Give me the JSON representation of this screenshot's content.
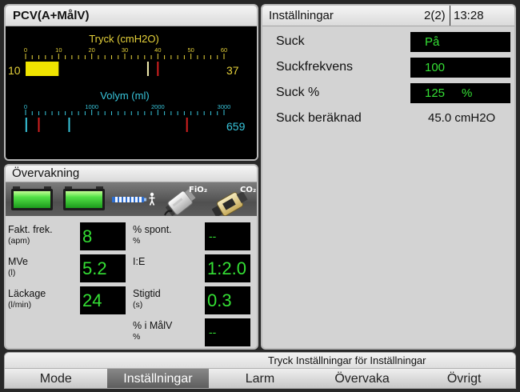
{
  "status_panel": {
    "mode": "PCV(A+MålV)",
    "pressure": {
      "title": "Tryck (cmH2O)",
      "min": 0,
      "max": 60,
      "tick_labels": [
        "0",
        "10",
        "20",
        "30",
        "40",
        "50",
        "60"
      ],
      "left_value": "10",
      "right_value": "37",
      "fill_value": 10,
      "markers": [
        {
          "value": 37,
          "color": "#f4eeb0"
        },
        {
          "value": 40,
          "color": "#d42020"
        }
      ],
      "color": "#e6d23a",
      "fill_color": "#f0e400"
    },
    "volume": {
      "title": "Volym (ml)",
      "min": 0,
      "max": 3000,
      "tick_labels": [
        "0",
        "1000",
        "2000",
        "3000"
      ],
      "right_value": "659",
      "markers": [
        {
          "value": 10,
          "color": "#38c6dc"
        },
        {
          "value": 200,
          "color": "#d42020"
        },
        {
          "value": 659,
          "color": "#38c6dc"
        },
        {
          "value": 2440,
          "color": "#d42020"
        }
      ],
      "color": "#38c6dc"
    }
  },
  "monitoring": {
    "title": "Övervakning",
    "batteries": [
      {
        "level": 1.0
      },
      {
        "level": 1.0
      }
    ],
    "icons": {
      "fio2_label": "FiO₂",
      "co2_label": "CO₂"
    },
    "params": [
      {
        "label": "Fakt. frek.",
        "unit": "(apm)",
        "value": "8"
      },
      {
        "label": "MVe",
        "unit": "(l)",
        "value": "5.2"
      },
      {
        "label": "Läckage",
        "unit": "(l/min)",
        "value": "24"
      },
      {
        "label": "% spont.",
        "unit": "%",
        "value": "--"
      },
      {
        "label": "I:E",
        "value": "1:2.0"
      },
      {
        "label": "Stigtid",
        "unit": "(s)",
        "value": "0.3"
      },
      {
        "label": "% i MålV",
        "unit": "%",
        "value": "--"
      }
    ]
  },
  "settings": {
    "title": "Inställningar",
    "page": "2(2)",
    "time": "13:28",
    "rows": [
      {
        "label": "Suck",
        "value": "På"
      },
      {
        "label": "Suckfrekvens",
        "value": "100"
      },
      {
        "label": "Suck %",
        "value": "125",
        "unit": "%"
      },
      {
        "label": "Suck beräknad",
        "value": "45.0 cmH2O"
      }
    ]
  },
  "footer": {
    "message": "Tryck Inställningar för Inställningar",
    "tabs": [
      {
        "label": "Mode"
      },
      {
        "label": "Inställningar",
        "selected": true
      },
      {
        "label": "Larm"
      },
      {
        "label": "Övervaka"
      },
      {
        "label": "Övrigt"
      }
    ]
  },
  "colors": {
    "value_text": "#34e034",
    "value_background": "#000000",
    "panel_background": "#d3d3d3",
    "selected_tab": "#6a6a6a"
  }
}
